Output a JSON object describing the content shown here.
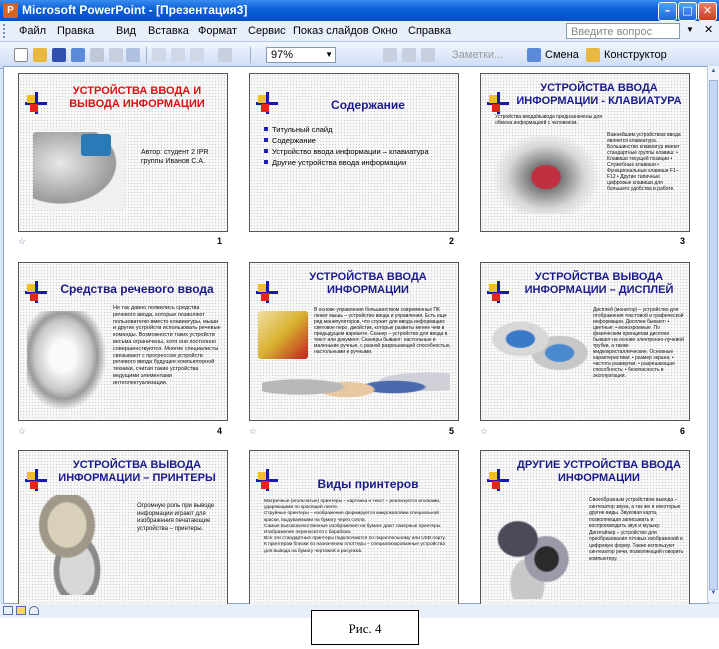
{
  "window": {
    "title": "Microsoft PowerPoint - [Презентация3]",
    "app_icon": "P"
  },
  "menu": [
    "Файл",
    "Правка",
    "Вид",
    "Вставка",
    "Формат",
    "Сервис",
    "Показ слайдов",
    "Окно",
    "Справка"
  ],
  "help": {
    "placeholder": "Введите вопрос"
  },
  "toolbar": {
    "zoom": "97%",
    "notes": "Заметки...",
    "transition": "Смена",
    "designer": "Конструктор"
  },
  "slides": [
    {
      "number": "1",
      "title": "УСТРОЙСТВА ВВОДА И ВЫВОДА ИНФОРМАЦИИ",
      "author": "Автор: студент 2 IPR группы Иванов С.А."
    },
    {
      "number": "2",
      "title": "Содержание",
      "items": [
        "Титульный слайд",
        "Содержание",
        "Устройство ввода информации – клавиатура",
        "Другие устройства ввода информации"
      ]
    },
    {
      "number": "3",
      "title": "УСТРОЙСТВА ВВОДА ИНФОРМАЦИИ - КЛАВИАТУРА",
      "intro": "Устройства ввода/вывода предназначены для обмена информацией с человеком.",
      "text": "Важнейшим устройством ввода является клавиатура. Большинство клавиатур имеют стандартные группы клавиш: • Клавиши текущей позиции • Служебные клавиши • Функциональные клавиши F1–F12 • Другие типичные цифровые клавиши для большего удобства в работе."
    },
    {
      "number": "4",
      "title": "Средства речевого ввода",
      "text": "Не так давно появились средства речевого ввода, которые позволяют пользователю вместо клавиатуры, мыши и других устройств использовать речевые команды. Возможности таких устройств весьма ограничены, хотя они постоянно совершенствуются. Многие специалисты связывают с прогрессом устройств речевого ввода будущее компьютерной техники, считая такие устройства ведущими элементами интеллектуализации."
    },
    {
      "number": "5",
      "title": "УСТРОЙСТВА ВВОДА ИНФОРМАЦИИ",
      "text": "В основе управления большинством современных ПК лежат мышь – устройство ввода и управления. Есть еще ряд манипуляторов, что служит для ввода информации: световое перо, джойстик, которые развиты менее чем в предыдущем варианте. Сканер – устройство для ввода в текст или документ. Сканеры бывают: настольные и маленькие ручные, с разной разрешающей способностью, настольными и ручными."
    },
    {
      "number": "6",
      "title": "УСТРОЙСТВА ВЫВОДА ИНФОРМАЦИИ – ДИСПЛЕЙ",
      "text": "Дисплей (монитор) – устройство для отображения текстовой и графической информации. Дисплеи бывают: • цветные; • монохромные. По физическим принципам дисплеи бывают на основе электронно-лучевой трубки, а также жидкокристаллические. Основные характеристики: • размер экрана; • частота развертки; • разрешающая способность; • безопасность в эксплуатации."
    },
    {
      "number": "",
      "title": "УСТРОЙСТВА ВЫВОДА ИНФОРМАЦИИ – ПРИНТЕРЫ",
      "text": "Огромную роль при выводе информации играют для изображения печатающие устройства – принтеры."
    },
    {
      "number": "",
      "title": "Виды принтеров",
      "items": [
        "Матричные (игольчатые) принтеры – картинка и текст – реализуется иголками, ударяющими по красящей ленте.",
        "Струйные принтеры – изображение формируется микрокаплями специальной краски, выдуваемыми на бумагу через сопла.",
        "Самые высококачественные изображения на бумаге дают лазерные принтеры. Изображение переносится с барабана.",
        "Все эти стандартные принтеры подключаются по параллельному или USB порту.",
        "К принтерам близки по назначению плоттеры – специализированные устройства для вывода на бумагу чертежей и рисунков."
      ]
    },
    {
      "number": "",
      "title": "ДРУГИЕ УСТРОЙСТВА ВВОДА ИНФОРМАЦИИ",
      "text": "Своеобразным устройством вывода – синтезатор звука, а так же и некоторые другие виды. Звуковая карта, позволяющая записывать и воспроизводить звук и музыку. Дигитайзер – устройство для преобразования готовых изображений в цифровую форму. Также используют синтезатор речи, позволяющий говорить компьютеру."
    }
  ],
  "figure_caption": "Рис. 4"
}
